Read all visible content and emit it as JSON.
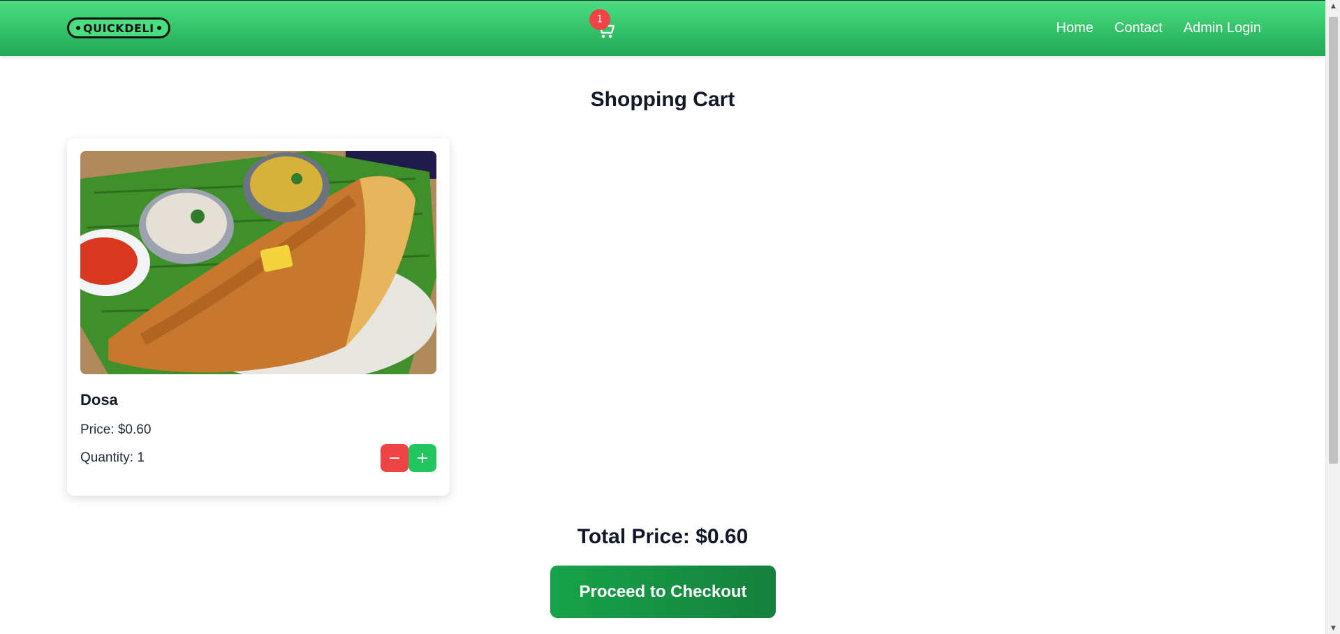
{
  "header": {
    "logo_text": "QUICKDELI",
    "cart_count": "1",
    "nav": [
      {
        "label": "Home"
      },
      {
        "label": "Contact"
      },
      {
        "label": "Admin Login"
      }
    ]
  },
  "main": {
    "title": "Shopping Cart",
    "items": [
      {
        "name": "Dosa",
        "price_text": "Price: $0.60",
        "quantity_text": "Quantity: 1",
        "minus_label": "−",
        "plus_label": "+"
      }
    ],
    "total_text": "Total Price: $0.60",
    "checkout_label": "Proceed to Checkout"
  },
  "colors": {
    "header_start": "#4ade80",
    "header_end": "#22a857",
    "badge": "#ef4444",
    "minus_button": "#ef4444",
    "plus_button": "#22c55e",
    "checkout": "#16a34a"
  }
}
